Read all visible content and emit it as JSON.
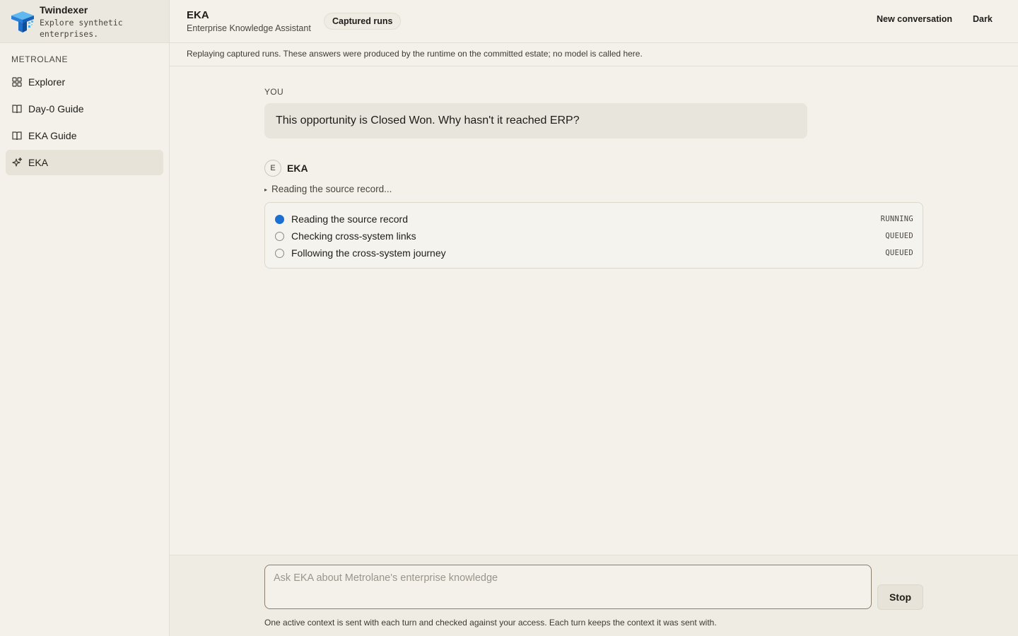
{
  "brand": {
    "name": "Twindexer",
    "tagline": "Explore synthetic enterprises."
  },
  "sidebar": {
    "section": "METROLANE",
    "items": [
      {
        "label": "Explorer",
        "icon": "grid-icon",
        "active": false
      },
      {
        "label": "Day-0 Guide",
        "icon": "book-icon",
        "active": false
      },
      {
        "label": "EKA Guide",
        "icon": "book-icon",
        "active": false
      },
      {
        "label": "EKA",
        "icon": "sparkle-icon",
        "active": true
      }
    ]
  },
  "header": {
    "title": "EKA",
    "subtitle": "Enterprise Knowledge Assistant",
    "badge": "Captured runs",
    "new_conversation": "New conversation",
    "theme": "Dark"
  },
  "notice": "Replaying captured runs. These answers were produced by the runtime on the committed estate; no model is called here.",
  "conversation": {
    "you_label": "YOU",
    "user_message": "This opportunity is Closed Won. Why hasn't it reached ERP?",
    "assistant_avatar": "E",
    "assistant_name": "EKA",
    "thinking": "Reading the source record...",
    "steps": [
      {
        "label": "Reading the source record",
        "status": "RUNNING"
      },
      {
        "label": "Checking cross-system links",
        "status": "QUEUED"
      },
      {
        "label": "Following the cross-system journey",
        "status": "QUEUED"
      }
    ]
  },
  "composer": {
    "placeholder": "Ask EKA about Metrolane's enterprise knowledge",
    "stop": "Stop",
    "note": "One active context is sent with each turn and checked against your access. Each turn keeps the context it was sent with."
  },
  "colors": {
    "accent_running": "#1a6fd1",
    "background": "#f3f1ea"
  }
}
